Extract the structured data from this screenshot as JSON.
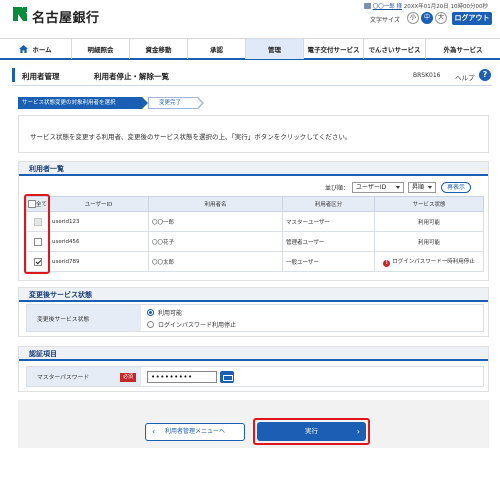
{
  "header": {
    "bank_name": "名古屋銀行",
    "user_name": "〇〇一郎 様",
    "last_login": "20XX年01月20日 10時00分00秒",
    "font_size_label": "文字サイズ",
    "font_sizes": [
      "小",
      "中",
      "大"
    ],
    "active_font_size": "中",
    "logout_label": "ログアウト"
  },
  "nav": {
    "items": [
      "ホーム",
      "明細照会",
      "資金移動",
      "承認",
      "管理",
      "電子交付サービス",
      "でんさいサービス",
      "外為サービス"
    ],
    "active": "管理"
  },
  "page": {
    "title_main": "利用者管理",
    "title_sub": "利用者停止・解除一覧",
    "screen_id": "BRSK016",
    "help_label": "ヘルプ",
    "help_icon": "?"
  },
  "steps": [
    "サービス状態変更の対象利用者を選択",
    "変更完了"
  ],
  "instruction": "サービス状態を変更する利用者、変更後のサービス状態を選択の上、「実行」ボタンをクリックしてください。",
  "user_list": {
    "section_title": "利用者一覧",
    "sort_label": "並び順：",
    "sort_field": "ユーザーID",
    "sort_order": "昇順",
    "resort_label": "再表示",
    "columns": [
      "全て",
      "ユーザーID",
      "利用者名",
      "利用者区分",
      "サービス状態"
    ],
    "rows": [
      {
        "checkbox": "disabled",
        "user_id": "userid123",
        "name": "〇〇一郎",
        "type": "マスターユーザー",
        "status": "利用可能",
        "warning": false
      },
      {
        "checkbox": "unchecked",
        "user_id": "userid456",
        "name": "〇〇花子",
        "type": "管理者ユーザー",
        "status": "利用可能",
        "warning": false
      },
      {
        "checkbox": "checked",
        "user_id": "userid789",
        "name": "〇〇太郎",
        "type": "一般ユーザー",
        "status": "ログインパスワード一時利用停止",
        "warning": true
      }
    ]
  },
  "service_change": {
    "section_title": "変更後サービス状態",
    "label": "変更後サービス状態",
    "options": [
      "利用可能",
      "ログインパスワード利用停止"
    ],
    "selected": "利用可能"
  },
  "auth": {
    "section_title": "認証項目",
    "label": "マスターパスワード",
    "required_label": "必須",
    "password_value": "•••••••••"
  },
  "buttons": {
    "back_label": "利用者管理メニューへ",
    "execute_label": "実行"
  },
  "colors": {
    "brand_blue": "#1a5fb4",
    "highlight_red": "#e0161e",
    "logo_green": "#0a8a3c"
  }
}
